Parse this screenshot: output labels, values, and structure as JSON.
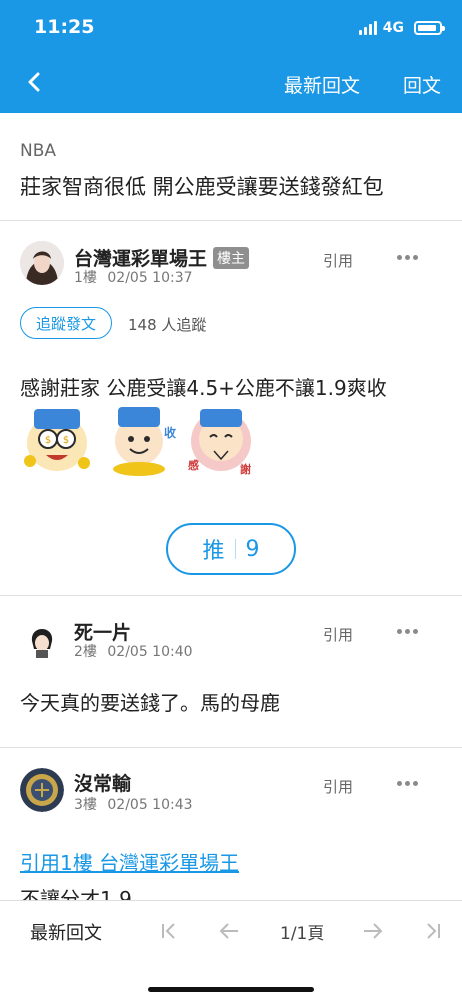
{
  "status": {
    "time": "11:25",
    "network": "4G"
  },
  "nav": {
    "latest_label": "最新回文",
    "reply_label": "回文"
  },
  "thread": {
    "board": "NBA",
    "title": "莊家智商很低 開公鹿受讓要送錢發紅包"
  },
  "posts": [
    {
      "username": "台灣運彩單場王",
      "badge": "樓主",
      "floor": "1樓",
      "time": "02/05 10:37",
      "quote_label": "引用",
      "follow_label": "追蹤發文",
      "followers": "148 人追蹤",
      "content": "感謝莊家 公鹿受讓4.5+公鹿不讓1.9爽收",
      "stickers": [
        "sticker-money-eyes",
        "sticker-collect",
        "sticker-thanks"
      ],
      "push_label": "推",
      "push_count": "9"
    },
    {
      "username": "死一片",
      "floor": "2樓",
      "time": "02/05 10:40",
      "quote_label": "引用",
      "content": "今天真的要送錢了。馬的母鹿"
    },
    {
      "username": "沒常輸",
      "floor": "3樓",
      "time": "02/05 10:43",
      "quote_label": "引用",
      "quote_link": "引用1樓 台灣運彩單場王",
      "content_partial": "不讓分才1.9"
    }
  ],
  "bottom": {
    "latest_label": "最新回文",
    "page": "1/1頁"
  },
  "colors": {
    "accent": "#1a98e5",
    "badge": "#8f8f8f"
  }
}
